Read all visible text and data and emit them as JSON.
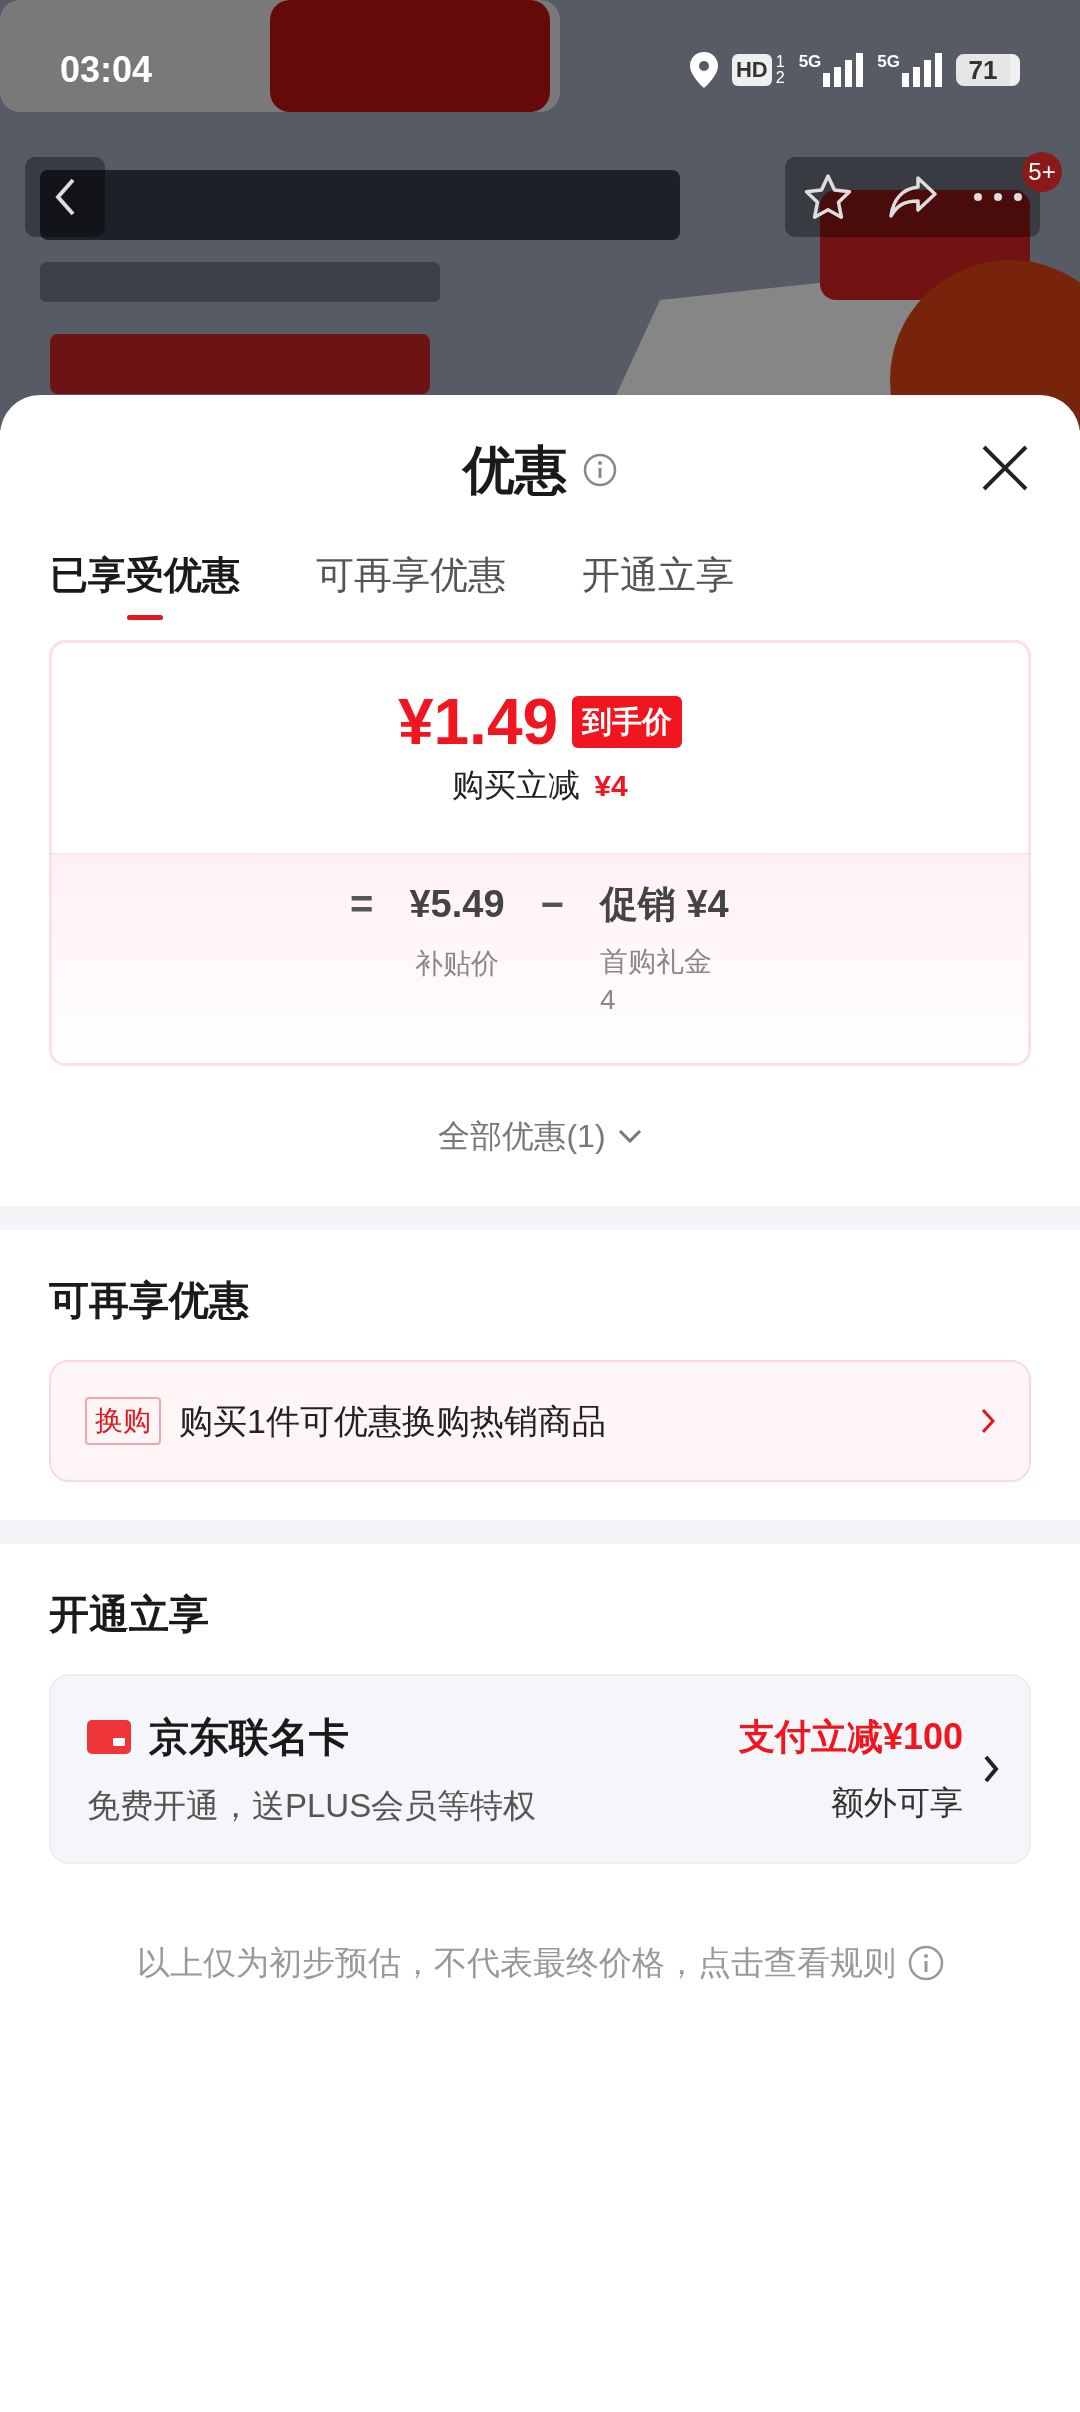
{
  "status_bar": {
    "time": "03:04",
    "hd_label": "HD",
    "sim_labels": [
      "1",
      "2"
    ],
    "signal_labels": [
      "5G",
      "5G"
    ],
    "battery": "71"
  },
  "product_header": {
    "kind": "picture",
    "cart_badge": "5+"
  },
  "sheet": {
    "title": "优惠",
    "tabs": [
      {
        "label": "已享受优惠",
        "selected": true
      },
      {
        "label": "可再享优惠",
        "selected": false
      },
      {
        "label": "开通立享",
        "selected": false
      }
    ],
    "summary": {
      "price": "¥1.49",
      "price_tag": "到手价",
      "reduction_label": "购买立减",
      "reduction_amount": "¥4",
      "equals": "=",
      "subsidy_price": "¥5.49",
      "subsidy_label": "补贴价",
      "minus": "−",
      "promo": "促销 ¥4",
      "promo_label": "首购礼金 4"
    },
    "expand_link": "全部优惠(1)",
    "sections": [
      {
        "kind": "exchange",
        "title": "可再享优惠",
        "tag": "换购",
        "text": "购买1件可优惠换购热销商品"
      },
      {
        "kind": "card",
        "title": "开通立享",
        "name": "京东联名卡",
        "desc": "免费开通，送PLUS会员等特权",
        "offer": "支付立减¥100",
        "offer_note": "额外可享"
      }
    ],
    "footer_note": "以上仅为初步预估，不代表最终价格，点击查看规则"
  }
}
